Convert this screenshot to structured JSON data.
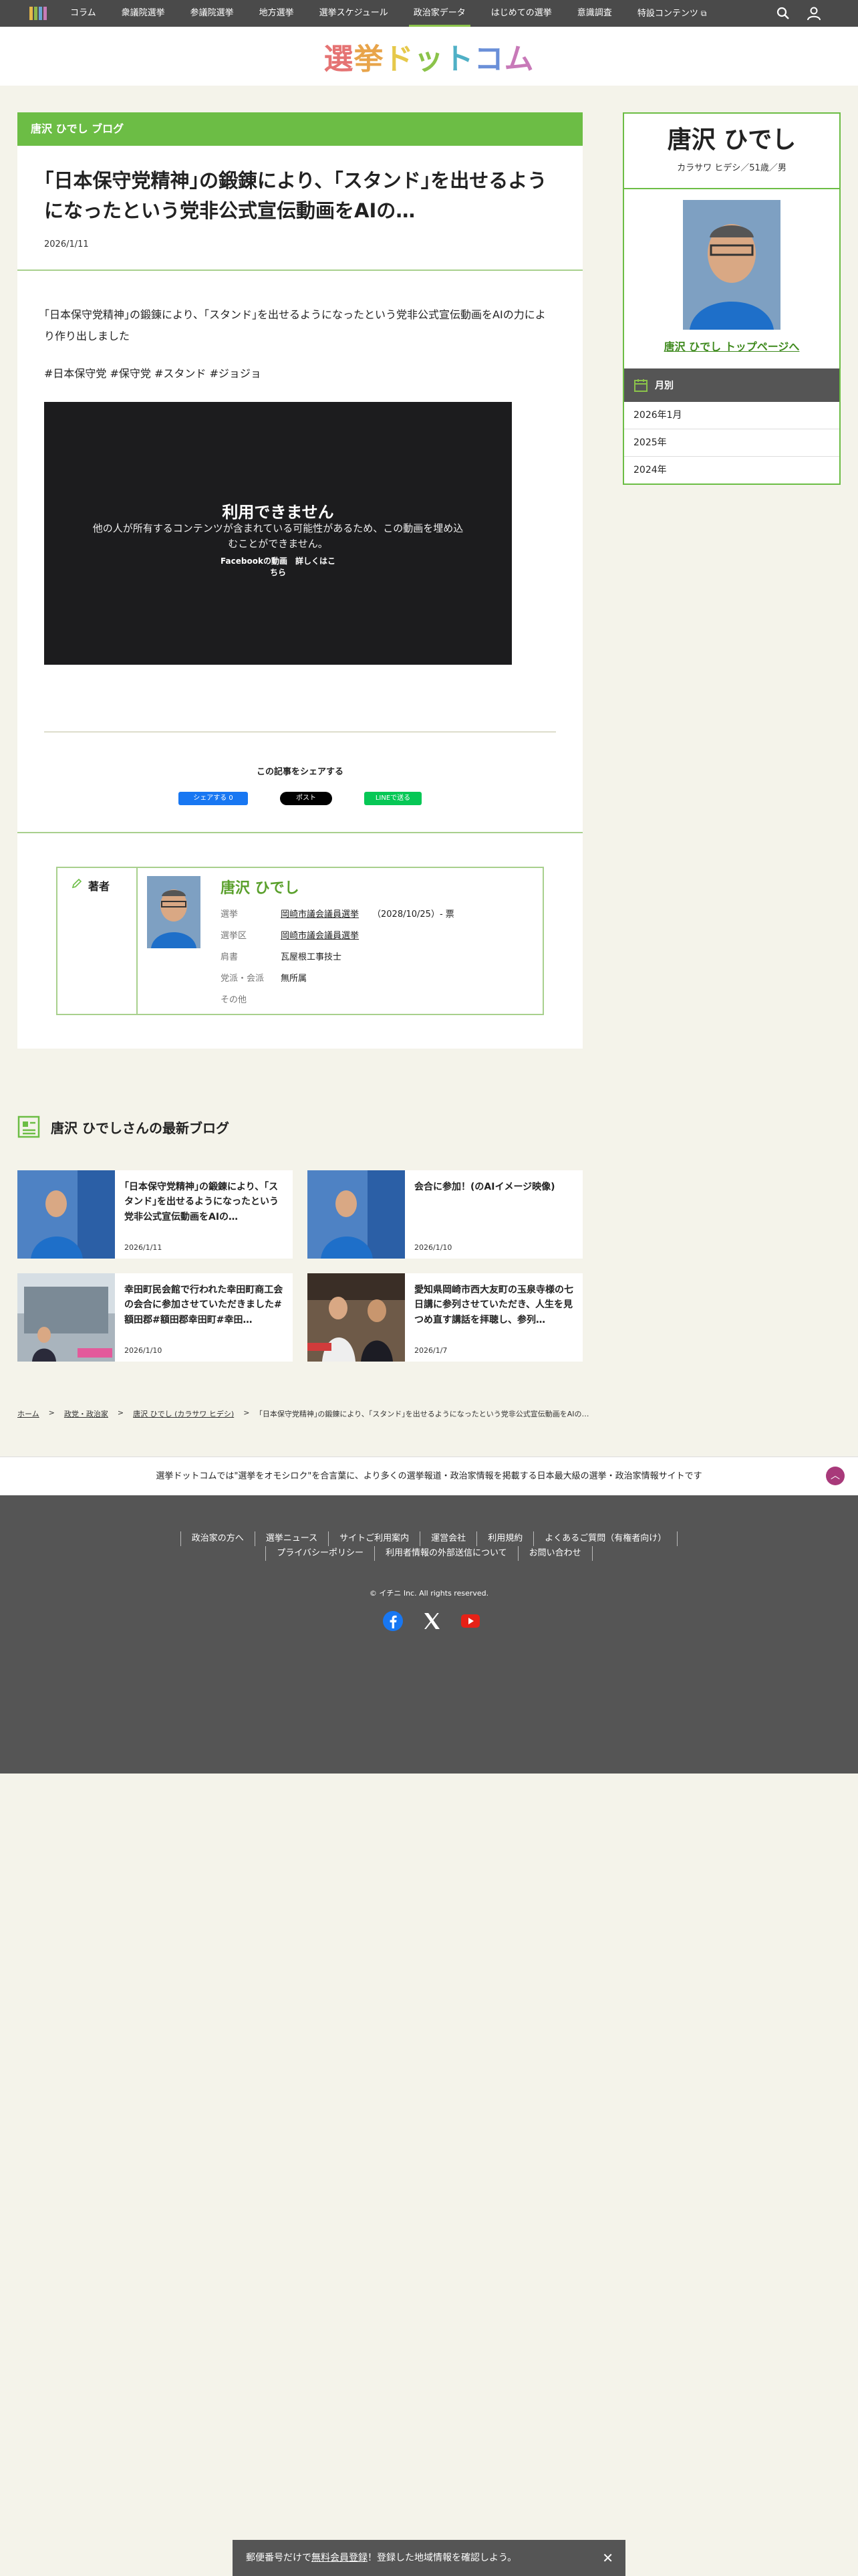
{
  "nav": {
    "items": [
      "コラム",
      "衆議院選挙",
      "参議院選挙",
      "地方選挙",
      "選挙スケジュール",
      "政治家データ",
      "はじめての選挙",
      "意識調査",
      "特設コンテンツ"
    ],
    "active_index": 5,
    "accent_color": "#8bc34a"
  },
  "header": {
    "logo_chars": [
      "選",
      "挙",
      "ド",
      "ッ",
      "ト",
      "コ",
      "ム"
    ]
  },
  "article": {
    "blog_label": "唐沢 ひでし ブログ",
    "title": "｢日本保守党精神｣の鍛錬により、｢スタンド｣を出せるようになったという党非公式宣伝動画をAIの…",
    "date": "2026/1/11",
    "body": "｢日本保守党精神｣の鍛錬により、｢スタンド｣を出せるようになったという党非公式宣伝動画をAIの力により作り出しました",
    "tags": "#日本保守党 #保守党 #スタンド #ジョジョ",
    "video": {
      "title": "利用できません",
      "desc": "他の人が所有するコンテンツが含まれている可能性があるため、この動画を埋め込むことができません。",
      "link": "Facebookの動画　詳しくはこちら"
    },
    "share": {
      "title": "この記事をシェアする",
      "fb": "シェアする 0",
      "x": "ポスト",
      "line": "LINEで送る"
    }
  },
  "author": {
    "label": "著者",
    "name": "唐沢 ひでし",
    "rows": [
      {
        "k": "選挙",
        "v": "岡崎市議会議員選挙",
        "extra": "（2028/10/25）- 票"
      },
      {
        "k": "選挙区",
        "v": "岡崎市議会議員選挙",
        "extra": ""
      },
      {
        "k": "肩書",
        "v": "瓦屋根工事技士",
        "extra": ""
      },
      {
        "k": "党派・会派",
        "v": "無所属",
        "extra": ""
      },
      {
        "k": "その他",
        "v": "",
        "extra": ""
      }
    ]
  },
  "sidebar": {
    "name": "唐沢 ひでし",
    "kana": "カラサワ ヒデシ／51歳／男",
    "top_link": "唐沢 ひでし トップページへ",
    "archive_label": "月別",
    "archive": [
      "2026年1月",
      "2025年",
      "2024年"
    ]
  },
  "latest": {
    "title": "唐沢 ひでしさんの最新ブログ",
    "cards": [
      {
        "title": "｢日本保守党精神｣の鍛錬により、｢スタンド｣を出せるようになったという党非公式宣伝動画をAIの…",
        "date": "2026/1/11"
      },
      {
        "title": "会合に参加！(のAIイメージ映像)",
        "date": "2026/1/10"
      },
      {
        "title": "幸田町民会館で行われた幸田町商工会の会合に参加させていただきました#額田郡#額田郡幸田町#幸田…",
        "date": "2026/1/10"
      },
      {
        "title": "愛知県岡崎市西大友町の玉泉寺様の七日講に参列させていただき、人生を見つめ直す講話を拝聴し、参列…",
        "date": "2026/1/7"
      }
    ]
  },
  "breadcrumb": [
    "ホーム",
    "政党・政治家",
    "唐沢 ひでし (カラサワ ヒデシ)",
    "｢日本保守党精神｣の鍛錬により、｢スタンド｣を出せるようになったという党非公式宣伝動画をAIの…"
  ],
  "footer": {
    "tagline": "選挙ドットコムでは\"選挙をオモシロク\"を合言葉に、より多くの選挙報道・政治家情報を掲載する日本最大級の選挙・政治家情報サイトです",
    "links_row1": [
      "政治家の方へ",
      "選挙ニュース",
      "サイトご利用案内",
      "運営会社",
      "利用規約",
      "よくあるご質問（有権者向け）"
    ],
    "links_row2": [
      "プライバシーポリシー",
      "利用者情報の外部送信について",
      "お問い合わせ"
    ],
    "copyright": "© イチニ Inc. All rights reserved."
  },
  "bottom_bar": {
    "pre": "郵便番号だけで",
    "link": "無料会員登録",
    "post": "！登録した地域情報を確認しよう。"
  }
}
